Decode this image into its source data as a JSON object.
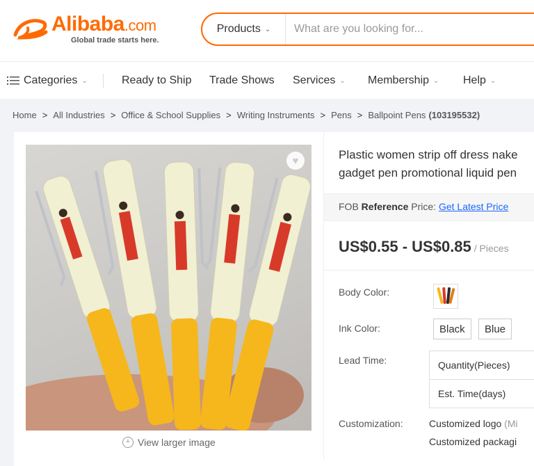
{
  "header": {
    "logo_word": "Alibaba",
    "logo_suffix": ".com",
    "logo_tagline": "Global trade starts here.",
    "logo_color": "#ff6a00",
    "search": {
      "category": "Products",
      "placeholder": "What are you looking for..."
    }
  },
  "nav": {
    "categories": "Categories",
    "ready_to_ship": "Ready to Ship",
    "trade_shows": "Trade Shows",
    "services": "Services",
    "membership": "Membership",
    "help": "Help"
  },
  "breadcrumb": {
    "items": [
      "Home",
      "All Industries",
      "Office & School Supplies",
      "Writing Instruments",
      "Pens",
      "Ballpoint Pens"
    ],
    "count": "(103195532)"
  },
  "product": {
    "title_line1": "Plastic women strip off dress nake",
    "title_line2": "gadget pen promotional liquid pen",
    "fob_prefix": "FOB",
    "fob_bold": "Reference",
    "fob_suffix": "Price:",
    "fob_link": "Get Latest Price",
    "price": "US$0.55 - US$0.85",
    "price_unit": "/ Pieces",
    "view_larger": "View larger image",
    "body_color_label": "Body Color:",
    "ink_color_label": "Ink Color:",
    "ink_colors": [
      "Black",
      "Blue"
    ],
    "lead_time_label": "Lead Time:",
    "lead_table": {
      "quantity_header": "Quantity(Pieces)",
      "time_header": "Est. Time(days)"
    },
    "customization_label": "Customization:",
    "customization_line1": "Customized logo",
    "customization_line1_muted": "(Mi",
    "customization_line2": "Customized packagi"
  },
  "icons": {
    "menu": "menu-icon",
    "favorite": "heart-icon",
    "zoom": "zoom-in-icon",
    "chevron": "chevron-down-icon"
  }
}
